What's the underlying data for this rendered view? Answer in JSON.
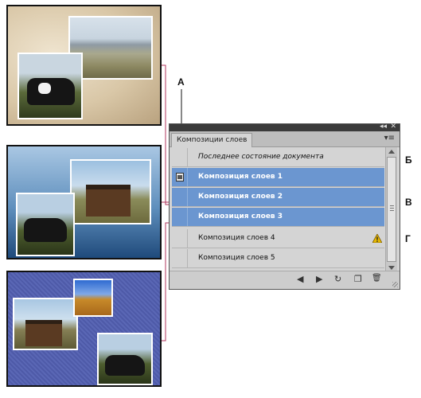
{
  "callouts": {
    "a": "A",
    "b": "Б",
    "v": "В",
    "g": "Г"
  },
  "panel": {
    "tab_label": "Композиции слоев",
    "close_glyph": "✕",
    "collapse_glyph": "◂◂",
    "menu_glyph": "▾≡",
    "rows": [
      {
        "label": "Последнее состояние документа",
        "selected": false
      },
      {
        "label": "Композиция слоев 1",
        "selected": true
      },
      {
        "label": "Композиция слоев 2",
        "selected": true
      },
      {
        "label": "Композиция слоев 3",
        "selected": true
      },
      {
        "label": "Композиция слоев 4",
        "selected": false,
        "warning": true
      },
      {
        "label": "Композиция слоев 5",
        "selected": false
      }
    ],
    "footer": {
      "prev_glyph": "◀",
      "next_glyph": "▶",
      "update_glyph": "↻",
      "new_glyph": "❐",
      "delete_glyph": "🗑"
    }
  },
  "colors": {
    "selection": "#6b96d0",
    "connector": "#b0365c",
    "warning": "#e6b800"
  }
}
